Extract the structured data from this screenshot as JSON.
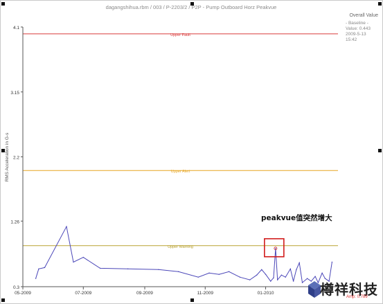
{
  "chart_data": {
    "type": "line",
    "title": "dagangshihua.rbm / 003 / P-2203/2 / P2P - Pump Outboard Horz Peakvue",
    "ylabel": "RMS Acceleration in G-s",
    "xlabel": "",
    "ylim": [
      0.3,
      4.1
    ],
    "xlim": [
      "2009-05-01",
      "2010-03-15"
    ],
    "y_ticks": [
      {
        "value": 0.3,
        "label": "0.3"
      },
      {
        "value": 1.26,
        "label": "1.26"
      },
      {
        "value": 2.2,
        "label": "2.2"
      },
      {
        "value": 3.15,
        "label": "3.15"
      },
      {
        "value": 4.1,
        "label": "4.1"
      }
    ],
    "x_ticks": [
      {
        "date": "2009-05-01",
        "label": "05-2009"
      },
      {
        "date": "2009-07-01",
        "label": "07-2009"
      },
      {
        "date": "2009-09-01",
        "label": "09-2009"
      },
      {
        "date": "2009-11-01",
        "label": "11-2009"
      },
      {
        "date": "2010-01-01",
        "label": "01-2010"
      }
    ],
    "thresholds": [
      {
        "name": "Upper Fault",
        "value": 4.0,
        "color": "#d93a3a"
      },
      {
        "name": "Upper Alert",
        "value": 2.0,
        "color": "#e7a520"
      },
      {
        "name": "Upper Warning",
        "value": 0.9,
        "color": "#b9a230"
      }
    ],
    "series": [
      {
        "name": "",
        "color": "#4a46b8",
        "points": [
          {
            "x": "2009-05-14",
            "y": 0.42
          },
          {
            "x": "2009-05-17",
            "y": 0.56
          },
          {
            "x": "2009-05-23",
            "y": 0.58
          },
          {
            "x": "2009-06-14",
            "y": 1.18
          },
          {
            "x": "2009-06-21",
            "y": 0.66
          },
          {
            "x": "2009-07-01",
            "y": 0.73
          },
          {
            "x": "2009-07-18",
            "y": 0.57
          },
          {
            "x": "2009-08-15",
            "y": 0.56
          },
          {
            "x": "2009-09-15",
            "y": 0.55
          },
          {
            "x": "2009-10-05",
            "y": 0.52
          },
          {
            "x": "2009-10-25",
            "y": 0.44
          },
          {
            "x": "2009-11-05",
            "y": 0.5
          },
          {
            "x": "2009-11-15",
            "y": 0.48
          },
          {
            "x": "2009-11-25",
            "y": 0.52
          },
          {
            "x": "2009-12-06",
            "y": 0.44
          },
          {
            "x": "2009-12-16",
            "y": 0.4
          },
          {
            "x": "2009-12-23",
            "y": 0.47
          },
          {
            "x": "2009-12-28",
            "y": 0.55
          },
          {
            "x": "2010-01-01",
            "y": 0.48
          },
          {
            "x": "2010-01-06",
            "y": 0.38
          },
          {
            "x": "2010-01-09",
            "y": 0.43
          },
          {
            "x": "2010-01-11",
            "y": 0.86
          },
          {
            "x": "2010-01-13",
            "y": 0.4
          },
          {
            "x": "2010-01-17",
            "y": 0.47
          },
          {
            "x": "2010-01-21",
            "y": 0.44
          },
          {
            "x": "2010-01-26",
            "y": 0.56
          },
          {
            "x": "2010-01-29",
            "y": 0.38
          },
          {
            "x": "2010-02-01",
            "y": 0.55
          },
          {
            "x": "2010-02-04",
            "y": 0.65
          },
          {
            "x": "2010-02-07",
            "y": 0.36
          },
          {
            "x": "2010-02-12",
            "y": 0.42
          },
          {
            "x": "2010-02-16",
            "y": 0.38
          },
          {
            "x": "2010-02-20",
            "y": 0.45
          },
          {
            "x": "2010-02-23",
            "y": 0.36
          },
          {
            "x": "2010-02-27",
            "y": 0.5
          },
          {
            "x": "2010-03-02",
            "y": 0.42
          },
          {
            "x": "2010-03-06",
            "y": 0.38
          },
          {
            "x": "2010-03-09",
            "y": 0.66
          }
        ]
      }
    ],
    "legend": {
      "title": "Overall Value",
      "lines": [
        "- Baseline -",
        "Value: 0.443",
        "2009-5-13",
        "15:42"
      ],
      "placement": "top-right"
    },
    "annotation": {
      "text": "peakvue值突然增大",
      "x": "2010-01-11",
      "y": 0.86,
      "box_color": "#d11a1a"
    },
    "grid": false
  },
  "watermark": {
    "text": "樽祥科技",
    "sub": "Amp: 0.789"
  },
  "colors": {
    "axis": "#555555",
    "tick_text": "#333333"
  }
}
